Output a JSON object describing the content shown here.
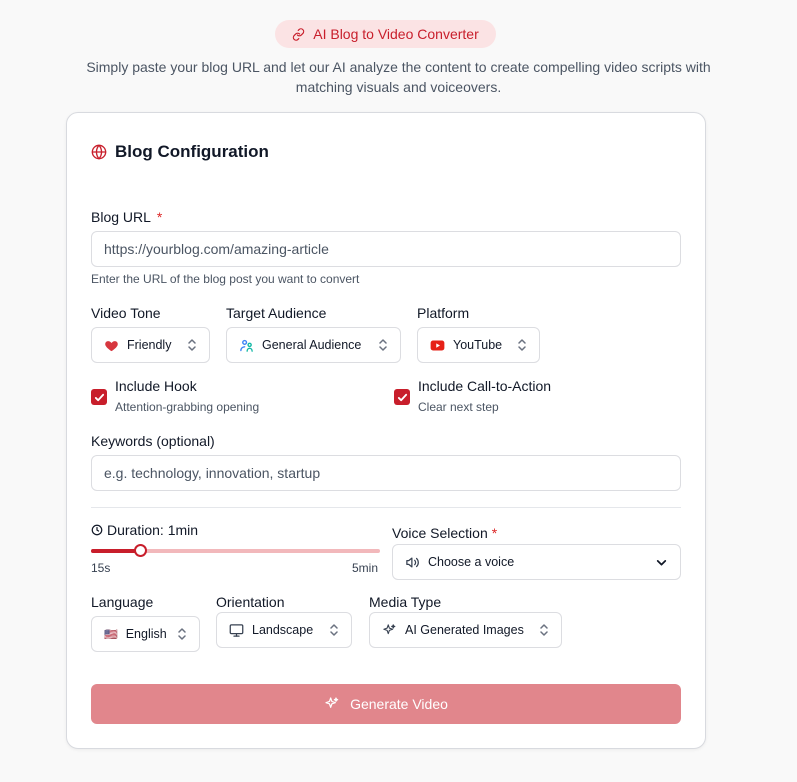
{
  "header": {
    "badge_label": "AI Blog to Video Converter",
    "subtitle": "Simply paste your blog URL and let our AI analyze the content to create compelling video scripts with matching visuals and voiceovers."
  },
  "card": {
    "title": "Blog Configuration",
    "blog_url": {
      "label": "Blog URL",
      "required_mark": "*",
      "placeholder": "https://yourblog.com/amazing-article",
      "helper": "Enter the URL of the blog post you want to convert"
    },
    "video_tone": {
      "label": "Video Tone",
      "value": "Friendly"
    },
    "target_audience": {
      "label": "Target Audience",
      "value": "General Audience"
    },
    "platform": {
      "label": "Platform",
      "value": "YouTube"
    },
    "include_hook": {
      "title": "Include Hook",
      "subtitle": "Attention-grabbing opening",
      "checked": true
    },
    "include_cta": {
      "title": "Include Call-to-Action",
      "subtitle": "Clear next step",
      "checked": true
    },
    "keywords": {
      "label": "Keywords (optional)",
      "placeholder": "e.g. technology, innovation, startup"
    },
    "duration": {
      "label": "Duration: 1min",
      "min_label": "15s",
      "max_label": "5min",
      "level": 0.17
    },
    "voice_selection": {
      "label": "Voice Selection",
      "required_mark": "*",
      "value": "Choose a voice"
    },
    "language": {
      "label": "Language",
      "value": "English",
      "flag": "🇺🇸"
    },
    "orientation": {
      "label": "Orientation",
      "value": "Landscape"
    },
    "media_type": {
      "label": "Media Type",
      "value": "AI Generated Images"
    },
    "generate_button": "Generate Video"
  },
  "colors": {
    "accent": "#c81e2b",
    "badge_bg": "#fbe3e4",
    "button_disabled": "#e1868c",
    "slider_track": "#f2b8bb"
  },
  "icons": [
    "link-icon",
    "globe-icon",
    "heart-icon",
    "users-icon",
    "youtube-icon",
    "check-icon",
    "clock-icon",
    "speaker-icon",
    "chevron-down-icon",
    "monitor-icon",
    "sparkles-icon",
    "chevron-updown-icon"
  ]
}
